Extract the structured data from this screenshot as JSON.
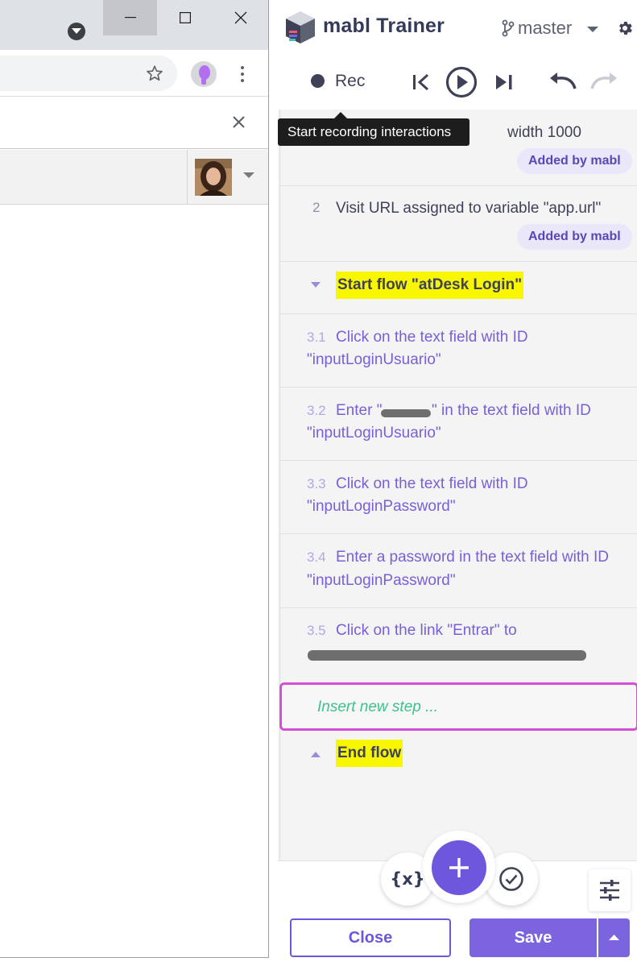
{
  "trainer": {
    "title": "mabl Trainer",
    "branch": "master",
    "rec_label": "Rec",
    "tooltip": "Start recording interactions"
  },
  "steps": [
    {
      "number": "",
      "text": "width 1000",
      "badge": "Added by mabl"
    },
    {
      "number": "2",
      "text": "Visit URL assigned to variable \"app.url\"",
      "badge": "Added by mabl"
    },
    {
      "flow_start": "Start flow \"atDesk Login\""
    },
    {
      "number": "3.1",
      "text_line1": "Click on the text field with ID",
      "text_line2": "\"inputLoginUsuario\""
    },
    {
      "number": "3.2",
      "text_line1_prefix": "Enter \"",
      "text_line1_suffix": "\" in the text field with ID",
      "text_line2": "\"inputLoginUsuario\""
    },
    {
      "number": "3.3",
      "text_line1": "Click on the text field with ID",
      "text_line2": "\"inputLoginPassword\""
    },
    {
      "number": "3.4",
      "text_line1": "Enter a password in the text field with ID",
      "text_line2": "\"inputLoginPassword\""
    },
    {
      "number": "3.5",
      "text_line1": "Click on the link \"Entrar\" to"
    },
    {
      "flow_end": "End flow"
    }
  ],
  "insert_placeholder": "Insert new step ...",
  "variables_label": "{x}",
  "buttons": {
    "close": "Close",
    "save": "Save"
  },
  "colors": {
    "accent": "#6e56dd",
    "highlight": "#f9f700",
    "insert_border": "#d64ed6",
    "insert_text": "#3ec28b"
  },
  "icons": [
    "tab-search-icon",
    "minimize-icon",
    "maximize-icon",
    "close-icon",
    "bookmark-star-icon",
    "profile-icon",
    "more-vert-icon",
    "infobar-close-icon",
    "user-avatar",
    "mabl-logo-icon",
    "branch-icon",
    "gear-icon",
    "skip-back-icon",
    "play-icon",
    "skip-forward-icon",
    "undo-icon",
    "redo-icon",
    "caret-down-icon",
    "caret-up-icon",
    "check-circle-icon",
    "plus-icon",
    "tune-icon"
  ]
}
